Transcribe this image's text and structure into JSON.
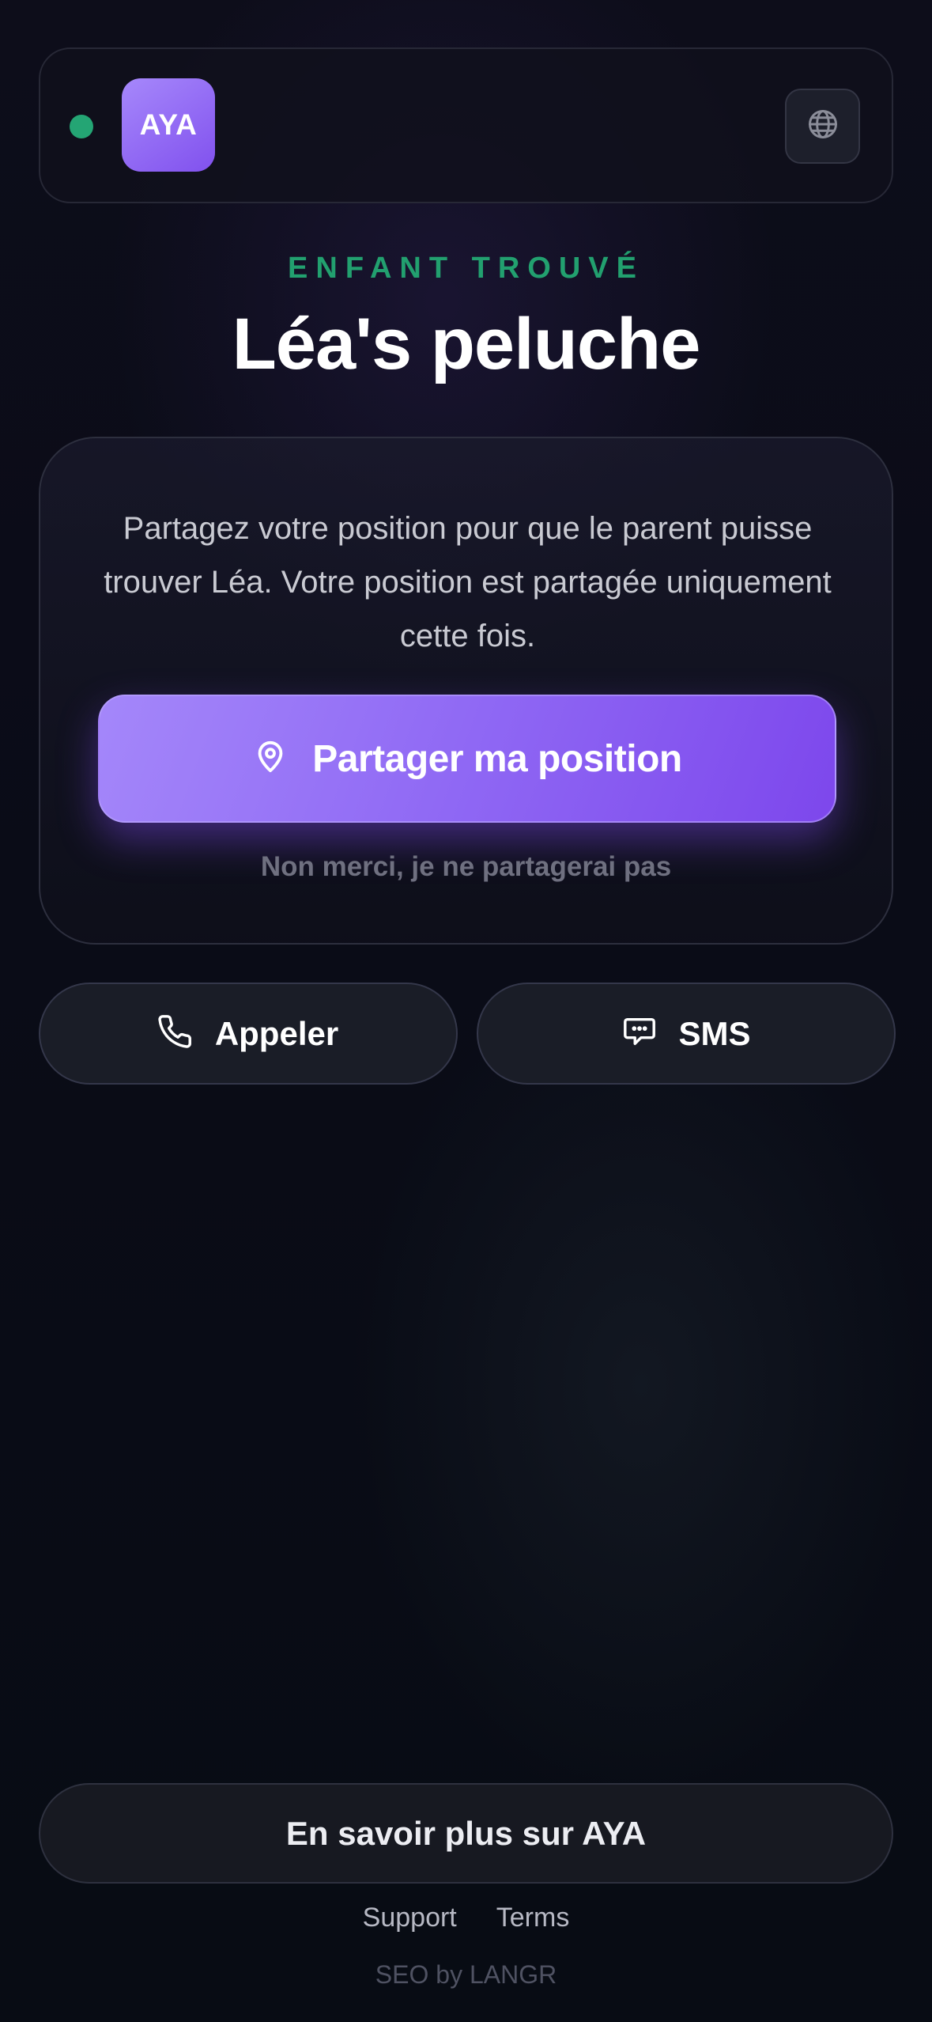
{
  "header": {
    "status_color": "#24a574",
    "logo_text": "AYA",
    "language_icon": "globe-icon"
  },
  "hero": {
    "eyebrow": "ENFANT TROUVÉ",
    "title": "Léa's peluche"
  },
  "share_card": {
    "message": "Partagez votre position pour que le parent puisse trouver Léa. Votre position est partagée uniquement cette fois.",
    "share_icon": "location-pin-icon",
    "share_label": "Partager ma position",
    "decline_label": "Non merci, je ne partagerai pas"
  },
  "actions": {
    "call_icon": "phone-icon",
    "call_label": "Appeler",
    "sms_icon": "chat-bubble-icon",
    "sms_label": "SMS"
  },
  "footer": {
    "learn_more_label": "En savoir plus sur AYA",
    "support_label": "Support",
    "terms_label": "Terms",
    "credit": "SEO by LANGR"
  },
  "colors": {
    "accent_purple": "#8f68f4",
    "accent_green": "#22a06f",
    "background": "#0b0c17"
  }
}
